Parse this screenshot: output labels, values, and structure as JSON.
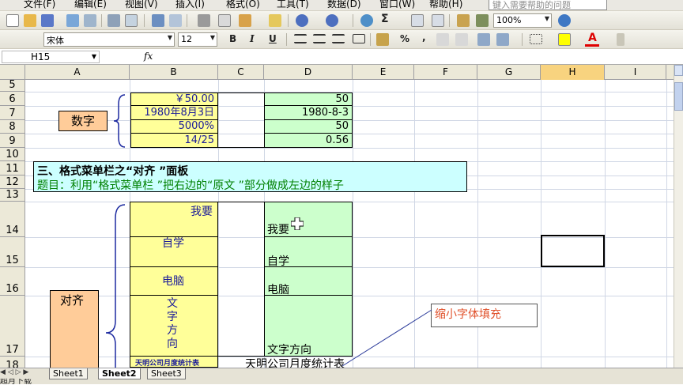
{
  "menu": {
    "items": [
      "文件(F)",
      "编辑(E)",
      "视图(V)",
      "插入(I)",
      "格式(O)",
      "工具(T)",
      "数据(D)",
      "窗口(W)",
      "帮助(H)"
    ],
    "help_placeholder": "键入需要帮助的问题"
  },
  "toolbar": {
    "zoom": "100%",
    "font_name": "宋体",
    "font_size": "12",
    "bold": "B",
    "italic": "I",
    "underline": "U",
    "percent": "%",
    "comma": ",",
    "sigma": "Σ"
  },
  "formula_bar": {
    "name_box": "H15",
    "fx": "fx",
    "content": ""
  },
  "columns": [
    "A",
    "B",
    "C",
    "D",
    "E",
    "F",
    "G",
    "H",
    "I"
  ],
  "selected_column": "H",
  "rows": [
    "5",
    "6",
    "7",
    "8",
    "9",
    "10",
    "11",
    "12",
    "13",
    "14",
    "15",
    "16",
    "17",
    "18"
  ],
  "cells": {
    "a_number": "数字",
    "b6": "￥50.00",
    "b7": "1980年8月3日",
    "b8": "5000%",
    "b9": "14/25",
    "d6": "50",
    "d7": "1980-8-3",
    "d8": "50",
    "d9": "0.56",
    "section_title": "三、格式菜单栏之“对齐 ”面板",
    "section_task": "题目：利用“格式菜单栏 ”把右边的“原文 ”部分做成左边的样子",
    "b14": "我要",
    "b15": "自学",
    "b16": "电脑",
    "b17_vertical": [
      "文",
      "字",
      "方",
      "向"
    ],
    "d14": "我要",
    "d15": "自学",
    "d16": "电脑",
    "d17": "文字方向",
    "b18": "天明公司月度统计表",
    "d18": "天明公司月度统计表",
    "a_align": "对齐",
    "callout": "缩小字体填充"
  },
  "sheets": [
    "Sheet1",
    "Sheet2",
    "Sheet3"
  ],
  "active_sheet": "Sheet2",
  "status": "超月下载",
  "colors": {
    "yellow_fill": "#ffff99",
    "green_fill": "#ccffcc",
    "orange_fill": "#ffcc99",
    "aqua_fill": "#ccffff",
    "callout_text": "#e0502a",
    "text_blue": "#1b1b99"
  }
}
